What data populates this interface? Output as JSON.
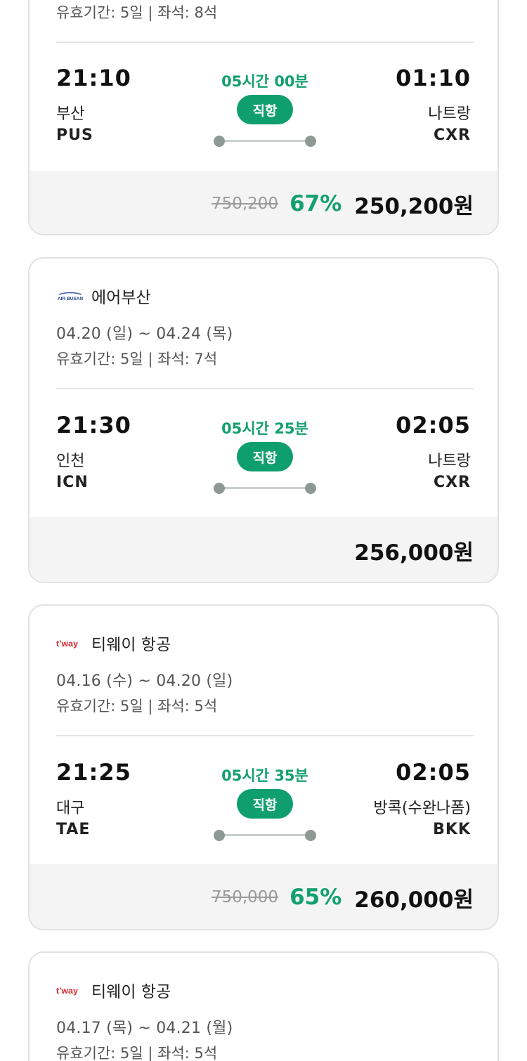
{
  "cards": [
    {
      "validity": "유효기간: 5일 | 좌석: 8석",
      "dep_time": "21:10",
      "dep_city": "부산",
      "dep_code": "PUS",
      "arr_time": "01:10",
      "arr_city": "나트랑",
      "arr_code": "CXR",
      "duration": "05시간 00분",
      "type": "직항",
      "original_price": "750,200",
      "discount": "67%",
      "price": "250,200원"
    },
    {
      "airline": "에어부산",
      "logo_icon": "air-busan-logo",
      "dates": "04.20 (일) ~ 04.24 (목)",
      "validity": "유효기간: 5일 | 좌석: 7석",
      "dep_time": "21:30",
      "dep_city": "인천",
      "dep_code": "ICN",
      "arr_time": "02:05",
      "arr_city": "나트랑",
      "arr_code": "CXR",
      "duration": "05시간 25분",
      "type": "직항",
      "price": "256,000원"
    },
    {
      "airline": "티웨이 항공",
      "logo_icon": "tway-logo",
      "dates": "04.16 (수) ~ 04.20 (일)",
      "validity": "유효기간: 5일 | 좌석: 5석",
      "dep_time": "21:25",
      "dep_city": "대구",
      "dep_code": "TAE",
      "arr_time": "02:05",
      "arr_city": "방콕(수완나폼)",
      "arr_code": "BKK",
      "duration": "05시간 35분",
      "type": "직항",
      "original_price": "750,000",
      "discount": "65%",
      "price": "260,000원"
    },
    {
      "airline": "티웨이 항공",
      "logo_icon": "tway-logo",
      "dates": "04.17 (목) ~ 04.21 (월)",
      "validity": "유효기간: 5일 | 좌석: 5석"
    }
  ],
  "colors": {
    "accent": "#0f9f6e",
    "discount": "#12a06f",
    "price_bg": "#f4f4f4"
  }
}
